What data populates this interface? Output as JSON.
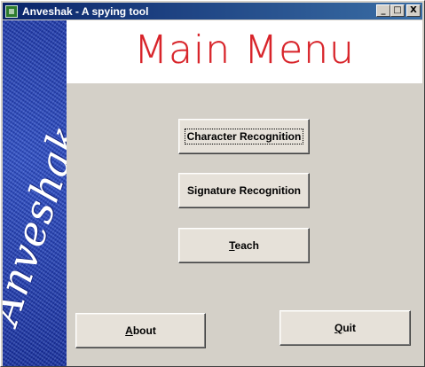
{
  "window": {
    "title": "Anveshak - A spying tool",
    "controls": {
      "minimize": "_",
      "maximize": "□",
      "close": "X"
    }
  },
  "sidebar": {
    "brand_text": "Anveshak"
  },
  "header": {
    "title": "Main Menu",
    "title_color": "#d8242a"
  },
  "buttons": {
    "character_recognition": "Character Recognition",
    "signature_recognition": "Signature Recognition",
    "teach": {
      "mnemonic": "T",
      "rest": "each"
    },
    "about": {
      "mnemonic": "A",
      "rest": "bout"
    },
    "quit": {
      "mnemonic": "Q",
      "rest": "uit"
    }
  },
  "colors": {
    "titlebar": "#0a246a",
    "sidebar": "#2244bb",
    "face": "#d4d0c8"
  }
}
